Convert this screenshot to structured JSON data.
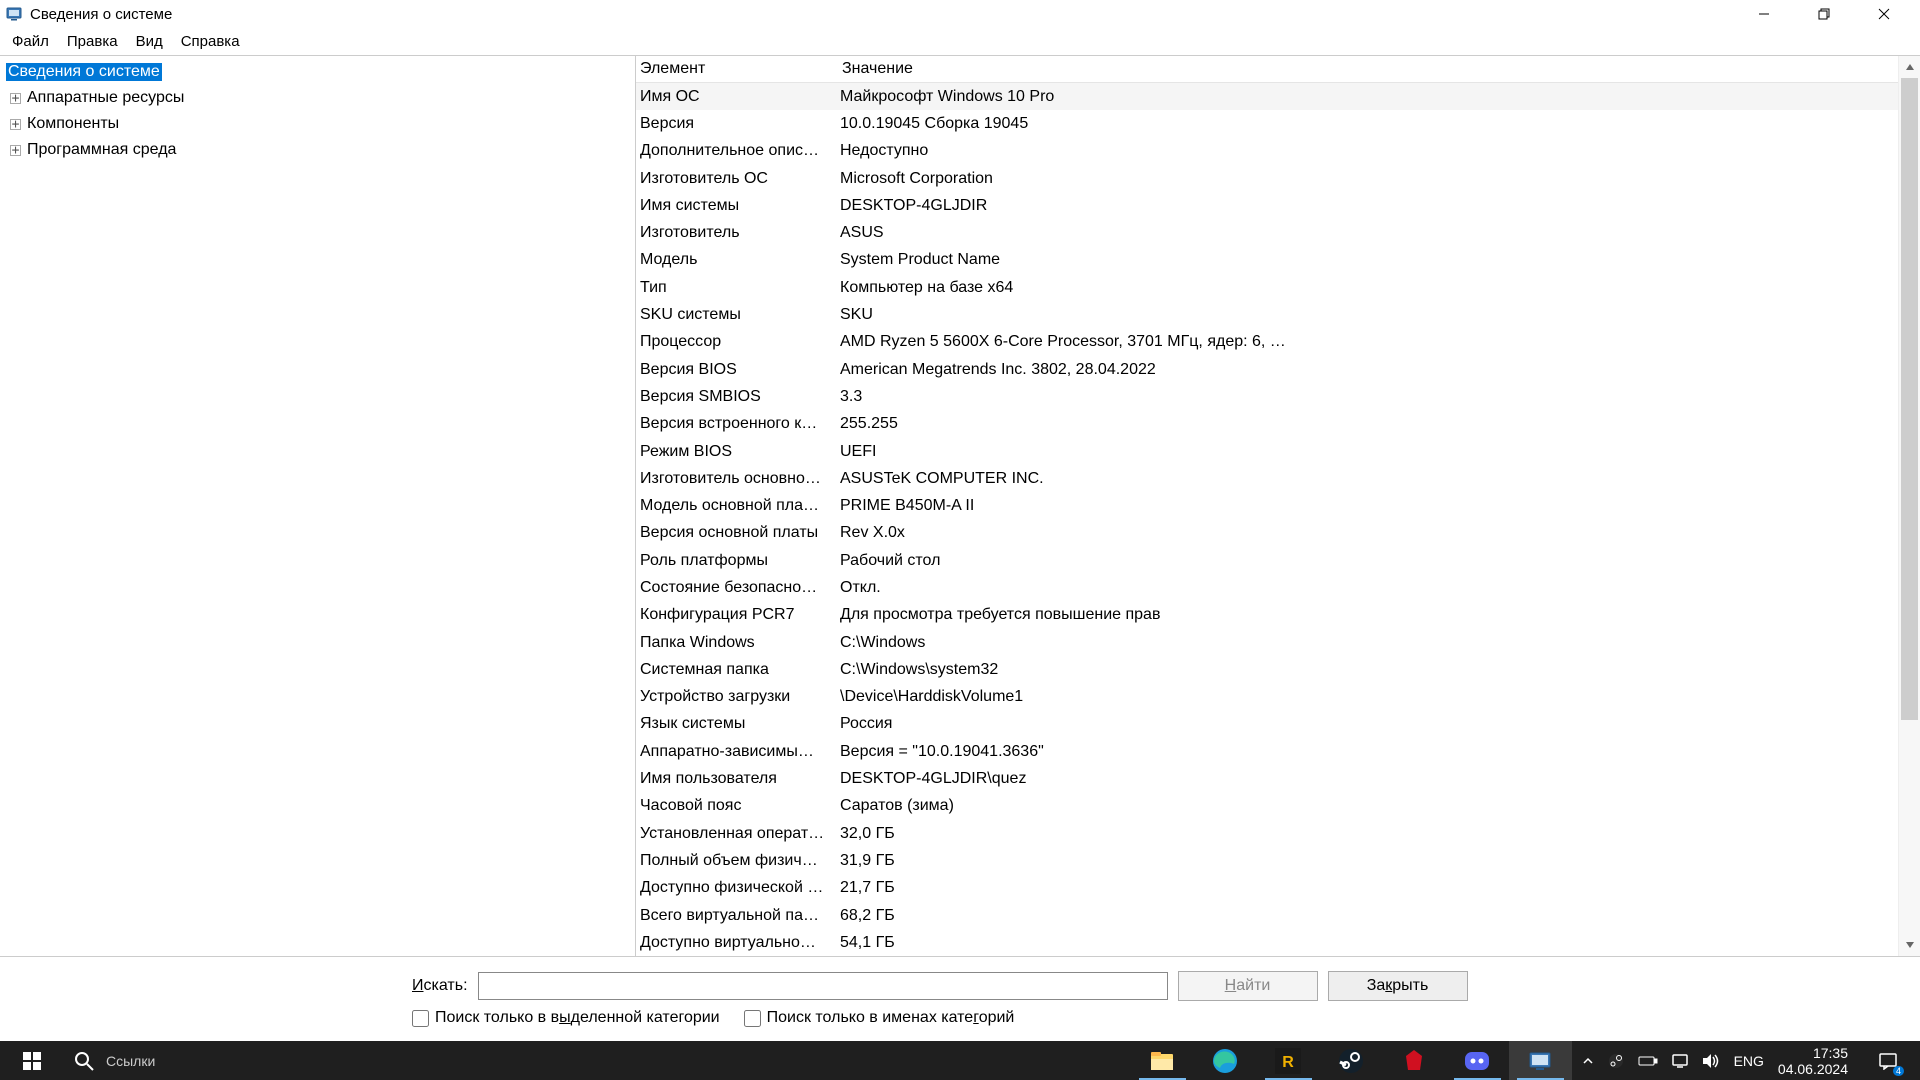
{
  "window": {
    "title": "Сведения о системе"
  },
  "menubar": [
    "Файл",
    "Правка",
    "Вид",
    "Справка"
  ],
  "tree": {
    "root": "Сведения о системе",
    "children": [
      "Аппаратные ресурсы",
      "Компоненты",
      "Программная среда"
    ]
  },
  "list": {
    "headers": [
      "Элемент",
      "Значение"
    ],
    "rows": [
      {
        "k": "Имя ОС",
        "v": "Майкрософт Windows 10 Pro",
        "sel": true
      },
      {
        "k": "Версия",
        "v": "10.0.19045 Сборка 19045"
      },
      {
        "k": "Дополнительное опис…",
        "v": "Недоступно"
      },
      {
        "k": "Изготовитель ОС",
        "v": "Microsoft Corporation"
      },
      {
        "k": "Имя системы",
        "v": "DESKTOP-4GLJDIR"
      },
      {
        "k": "Изготовитель",
        "v": "ASUS"
      },
      {
        "k": "Модель",
        "v": "System Product Name"
      },
      {
        "k": "Тип",
        "v": "Компьютер на базе x64"
      },
      {
        "k": "SKU системы",
        "v": "SKU"
      },
      {
        "k": "Процессор",
        "v": "AMD Ryzen 5 5600X 6-Core Processor, 3701 МГц, ядер: 6, …"
      },
      {
        "k": "Версия BIOS",
        "v": "American Megatrends Inc. 3802, 28.04.2022"
      },
      {
        "k": "Версия SMBIOS",
        "v": "3.3"
      },
      {
        "k": "Версия встроенного к…",
        "v": "255.255"
      },
      {
        "k": "Режим BIOS",
        "v": "UEFI"
      },
      {
        "k": "Изготовитель основно…",
        "v": "ASUSTeK COMPUTER INC."
      },
      {
        "k": "Модель основной пла…",
        "v": "PRIME B450M-A II"
      },
      {
        "k": "Версия основной платы",
        "v": "Rev X.0x"
      },
      {
        "k": "Роль платформы",
        "v": "Рабочий стол"
      },
      {
        "k": "Состояние безопасно…",
        "v": "Откл."
      },
      {
        "k": "Конфигурация PCR7",
        "v": "Для просмотра требуется повышение прав"
      },
      {
        "k": "Папка Windows",
        "v": "C:\\Windows"
      },
      {
        "k": "Системная папка",
        "v": "C:\\Windows\\system32"
      },
      {
        "k": "Устройство загрузки",
        "v": "\\Device\\HarddiskVolume1"
      },
      {
        "k": "Язык системы",
        "v": "Россия"
      },
      {
        "k": "Аппаратно-зависимы…",
        "v": "Версия = \"10.0.19041.3636\""
      },
      {
        "k": "Имя пользователя",
        "v": "DESKTOP-4GLJDIR\\quez"
      },
      {
        "k": "Часовой пояс",
        "v": "Саратов (зима)"
      },
      {
        "k": "Установленная операт…",
        "v": "32,0 ГБ"
      },
      {
        "k": "Полный объем физич…",
        "v": "31,9 ГБ"
      },
      {
        "k": "Доступно физической …",
        "v": "21,7 ГБ"
      },
      {
        "k": "Всего виртуальной па…",
        "v": "68,2 ГБ"
      },
      {
        "k": "Доступно виртуально…",
        "v": "54,1 ГБ"
      }
    ]
  },
  "footer": {
    "search_label_pre": "И",
    "search_label_rest": "скать:",
    "find_button": "Найти",
    "close_button_pre": "За",
    "close_button_u": "к",
    "close_button_rest": "рыть",
    "chk1_pre": "Поиск только в в",
    "chk1_u": "ы",
    "chk1_rest": "деленной категории",
    "chk2_pre": "Поиск только в именах кате",
    "chk2_u": "г",
    "chk2_rest": "орий"
  },
  "taskbar": {
    "search_placeholder": "Ссылки",
    "lang": "ENG",
    "time": "17:35",
    "date": "04.06.2024",
    "notif_count": "4"
  }
}
